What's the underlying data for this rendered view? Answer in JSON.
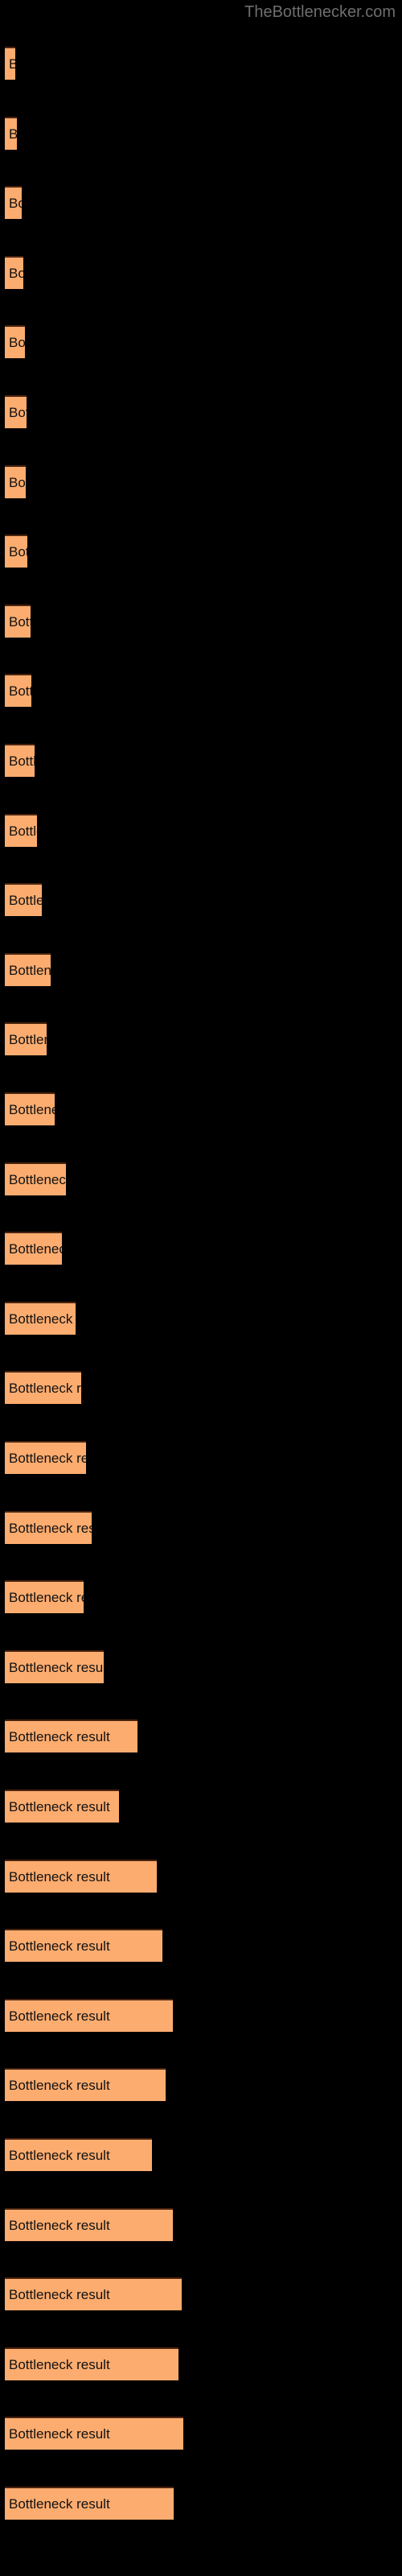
{
  "header": {
    "site_title": "TheBottlenecker.com"
  },
  "colors": {
    "background": "#000000",
    "bar_fill": "#fcac6f",
    "bar_border_top": "#4a2410",
    "bar_label_text": "#111111",
    "header_text": "#6e6e6e"
  },
  "chart_data": {
    "type": "bar",
    "orientation": "horizontal",
    "title": "",
    "subtitle": "",
    "xlabel": "",
    "ylabel": "",
    "grid": false,
    "legend": null,
    "axis_visible": false,
    "tick_labels": [],
    "bar_label_text": "Bottleneck result",
    "categories": [
      "Bottleneck result",
      "Bottleneck result",
      "Bottleneck result",
      "Bottleneck result",
      "Bottleneck result",
      "Bottleneck result",
      "Bottleneck result",
      "Bottleneck result",
      "Bottleneck result",
      "Bottleneck result",
      "Bottleneck result",
      "Bottleneck result",
      "Bottleneck result",
      "Bottleneck result",
      "Bottleneck result",
      "Bottleneck result",
      "Bottleneck result",
      "Bottleneck result",
      "Bottleneck result",
      "Bottleneck result",
      "Bottleneck result",
      "Bottleneck result",
      "Bottleneck result",
      "Bottleneck result",
      "Bottleneck result",
      "Bottleneck result",
      "Bottleneck result",
      "Bottleneck result",
      "Bottleneck result",
      "Bottleneck result",
      "Bottleneck result",
      "Bottleneck result",
      "Bottleneck result",
      "Bottleneck result",
      "Bottleneck result",
      "Bottleneck result"
    ],
    "values": [
      13,
      15,
      21,
      23,
      25,
      27,
      26,
      28,
      32,
      33,
      37,
      40,
      46,
      57,
      52,
      62,
      76,
      71,
      88,
      95,
      101,
      108,
      98,
      123,
      165,
      142,
      189,
      196,
      209,
      200,
      183,
      209,
      220,
      216,
      222,
      210
    ],
    "bar_pixel_widths": [
      13,
      15,
      21,
      23,
      25,
      27,
      26,
      28,
      32,
      33,
      37,
      40,
      46,
      57,
      52,
      62,
      76,
      71,
      88,
      95,
      101,
      108,
      98,
      123,
      165,
      142,
      189,
      196,
      209,
      200,
      183,
      209,
      220,
      216,
      222,
      210
    ],
    "xlim": [
      0,
      240
    ],
    "bar_count": 36
  }
}
